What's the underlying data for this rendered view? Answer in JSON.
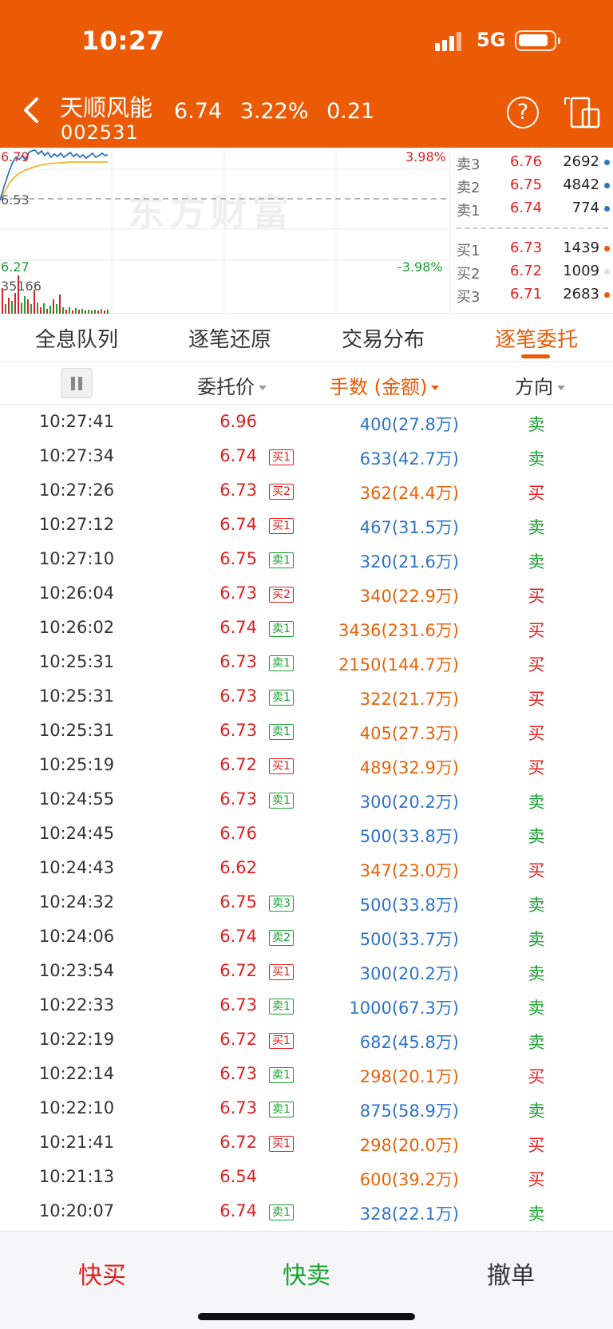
{
  "status": {
    "time": "10:27",
    "network": "5G"
  },
  "header": {
    "stock_name": "天顺风能",
    "stock_code": "002531",
    "price": "6.74",
    "change_pct": "3.22%",
    "change": "0.21",
    "help_label": "?"
  },
  "chart": {
    "high": "6.79",
    "base": "6.53",
    "low": "6.27",
    "up_pct": "3.98%",
    "down_pct": "-3.98%",
    "volume": "35166",
    "watermark": "东方财富"
  },
  "order_book": {
    "asks": [
      {
        "level": "卖3",
        "price": "6.76",
        "qty": "2692"
      },
      {
        "level": "卖2",
        "price": "6.75",
        "qty": "4842"
      },
      {
        "level": "卖1",
        "price": "6.74",
        "qty": "774"
      }
    ],
    "bids": [
      {
        "level": "买1",
        "price": "6.73",
        "qty": "1439"
      },
      {
        "level": "买2",
        "price": "6.72",
        "qty": "1009"
      },
      {
        "level": "买3",
        "price": "6.71",
        "qty": "2683"
      }
    ]
  },
  "tabs": [
    {
      "label": "全息队列"
    },
    {
      "label": "逐笔还原"
    },
    {
      "label": "交易分布"
    },
    {
      "label": "逐笔委托"
    }
  ],
  "columns": {
    "price": "委托价",
    "volume": "手数 (金额)",
    "direction": "方向"
  },
  "rows": [
    {
      "time": "10:27:41",
      "price": "6.96",
      "tag": "",
      "tag_type": "",
      "volume": "400(27.8万)",
      "direction": "卖"
    },
    {
      "time": "10:27:34",
      "price": "6.74",
      "tag": "买1",
      "tag_type": "buy",
      "volume": "633(42.7万)",
      "direction": "卖"
    },
    {
      "time": "10:27:26",
      "price": "6.73",
      "tag": "买2",
      "tag_type": "buy",
      "volume": "362(24.4万)",
      "direction": "买"
    },
    {
      "time": "10:27:12",
      "price": "6.74",
      "tag": "买1",
      "tag_type": "buy",
      "volume": "467(31.5万)",
      "direction": "卖"
    },
    {
      "time": "10:27:10",
      "price": "6.75",
      "tag": "卖1",
      "tag_type": "sell",
      "volume": "320(21.6万)",
      "direction": "卖"
    },
    {
      "time": "10:26:04",
      "price": "6.73",
      "tag": "买2",
      "tag_type": "buy",
      "volume": "340(22.9万)",
      "direction": "买"
    },
    {
      "time": "10:26:02",
      "price": "6.74",
      "tag": "卖1",
      "tag_type": "sell",
      "volume": "3436(231.6万)",
      "direction": "买"
    },
    {
      "time": "10:25:31",
      "price": "6.73",
      "tag": "卖1",
      "tag_type": "sell",
      "volume": "2150(144.7万)",
      "direction": "买"
    },
    {
      "time": "10:25:31",
      "price": "6.73",
      "tag": "卖1",
      "tag_type": "sell",
      "volume": "322(21.7万)",
      "direction": "买"
    },
    {
      "time": "10:25:31",
      "price": "6.73",
      "tag": "卖1",
      "tag_type": "sell",
      "volume": "405(27.3万)",
      "direction": "买"
    },
    {
      "time": "10:25:19",
      "price": "6.72",
      "tag": "买1",
      "tag_type": "buy",
      "volume": "489(32.9万)",
      "direction": "买"
    },
    {
      "time": "10:24:55",
      "price": "6.73",
      "tag": "卖1",
      "tag_type": "sell",
      "volume": "300(20.2万)",
      "direction": "卖"
    },
    {
      "time": "10:24:45",
      "price": "6.76",
      "tag": "",
      "tag_type": "",
      "volume": "500(33.8万)",
      "direction": "卖"
    },
    {
      "time": "10:24:43",
      "price": "6.62",
      "tag": "",
      "tag_type": "",
      "volume": "347(23.0万)",
      "direction": "买"
    },
    {
      "time": "10:24:32",
      "price": "6.75",
      "tag": "卖3",
      "tag_type": "sell",
      "volume": "500(33.8万)",
      "direction": "卖"
    },
    {
      "time": "10:24:06",
      "price": "6.74",
      "tag": "卖2",
      "tag_type": "sell",
      "volume": "500(33.7万)",
      "direction": "卖"
    },
    {
      "time": "10:23:54",
      "price": "6.72",
      "tag": "买1",
      "tag_type": "buy",
      "volume": "300(20.2万)",
      "direction": "卖"
    },
    {
      "time": "10:22:33",
      "price": "6.73",
      "tag": "卖1",
      "tag_type": "sell",
      "volume": "1000(67.3万)",
      "direction": "卖"
    },
    {
      "time": "10:22:19",
      "price": "6.72",
      "tag": "买1",
      "tag_type": "buy",
      "volume": "682(45.8万)",
      "direction": "卖"
    },
    {
      "time": "10:22:14",
      "price": "6.73",
      "tag": "卖1",
      "tag_type": "sell",
      "volume": "298(20.1万)",
      "direction": "买"
    },
    {
      "time": "10:22:10",
      "price": "6.73",
      "tag": "卖1",
      "tag_type": "sell",
      "volume": "875(58.9万)",
      "direction": "卖"
    },
    {
      "time": "10:21:41",
      "price": "6.72",
      "tag": "买1",
      "tag_type": "buy",
      "volume": "298(20.0万)",
      "direction": "买"
    },
    {
      "time": "10:21:13",
      "price": "6.54",
      "tag": "",
      "tag_type": "",
      "volume": "600(39.2万)",
      "direction": "买"
    },
    {
      "time": "10:20:07",
      "price": "6.74",
      "tag": "卖1",
      "tag_type": "sell",
      "volume": "328(22.1万)",
      "direction": "卖"
    }
  ],
  "bottom": {
    "quick_buy": "快买",
    "quick_sell": "快卖",
    "cancel": "撤单"
  },
  "colors": {
    "brand": "#eb5b06",
    "up": "#e02020",
    "down": "#18a030",
    "sell_volume": "#2f74c6",
    "buy_volume": "#e8630a"
  }
}
